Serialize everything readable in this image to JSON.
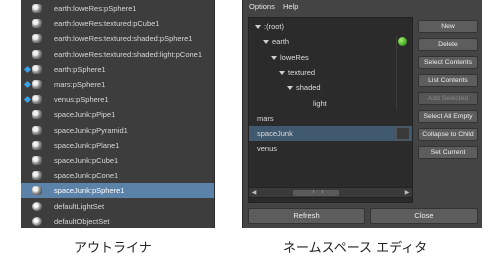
{
  "outliner": {
    "rows": [
      {
        "label": "earth:loweRes:pSphere1",
        "icon": "mesh-icon",
        "diamond": false,
        "selected": false
      },
      {
        "label": "earth:loweRes:textured:pCube1",
        "icon": "mesh-icon",
        "diamond": false,
        "selected": false
      },
      {
        "label": "earth:loweRes:textured:shaded:pSphere1",
        "icon": "mesh-icon",
        "diamond": false,
        "selected": false
      },
      {
        "label": "earth:loweRes:textured:shaded:light:pCone1",
        "icon": "mesh-icon",
        "diamond": false,
        "selected": false
      },
      {
        "label": "earth:pSphere1",
        "icon": "mesh-icon",
        "diamond": true,
        "selected": false
      },
      {
        "label": "mars:pSphere1",
        "icon": "mesh-icon",
        "diamond": true,
        "selected": false
      },
      {
        "label": "venus:pSphere1",
        "icon": "mesh-icon",
        "diamond": true,
        "selected": false
      },
      {
        "label": "spaceJunk:pPipe1",
        "icon": "mesh-icon",
        "diamond": false,
        "selected": false
      },
      {
        "label": "spaceJunk:pPyramid1",
        "icon": "mesh-icon",
        "diamond": false,
        "selected": false
      },
      {
        "label": "spaceJunk:pPlane1",
        "icon": "mesh-icon",
        "diamond": false,
        "selected": false
      },
      {
        "label": "spaceJunk:pCube1",
        "icon": "mesh-icon",
        "diamond": false,
        "selected": false
      },
      {
        "label": "spaceJunk:pCone1",
        "icon": "mesh-icon",
        "diamond": false,
        "selected": false
      },
      {
        "label": "spaceJunk:pSphere1",
        "icon": "mesh-icon",
        "diamond": false,
        "selected": true
      },
      {
        "label": "defaultLightSet",
        "icon": "set-icon",
        "diamond": false,
        "selected": false
      },
      {
        "label": "defaultObjectSet",
        "icon": "set-icon",
        "diamond": false,
        "selected": false
      }
    ]
  },
  "namespace_editor": {
    "menu": [
      "Options",
      "Help"
    ],
    "tree": [
      {
        "label": ":(root)",
        "expanded": true,
        "green_dot": false,
        "selected": false
      },
      {
        "label": "earth",
        "expanded": true,
        "green_dot": true,
        "selected": false
      },
      {
        "label": "loweRes",
        "expanded": true,
        "green_dot": false,
        "selected": false
      },
      {
        "label": "textured",
        "expanded": true,
        "green_dot": false,
        "selected": false
      },
      {
        "label": "shaded",
        "expanded": true,
        "green_dot": false,
        "selected": false
      },
      {
        "label": "light",
        "expanded": false,
        "green_dot": false,
        "selected": false
      },
      {
        "label": "mars",
        "expanded": false,
        "green_dot": false,
        "selected": false
      },
      {
        "label": "spaceJunk",
        "expanded": false,
        "green_dot": false,
        "selected": true
      },
      {
        "label": "venus",
        "expanded": false,
        "green_dot": false,
        "selected": false
      }
    ],
    "buttons": [
      {
        "label": "New",
        "enabled": true
      },
      {
        "label": "Delete",
        "enabled": true
      },
      {
        "label": "Select Contents",
        "enabled": true
      },
      {
        "label": "List Contents",
        "enabled": true
      },
      {
        "label": "Add Selected",
        "enabled": false
      },
      {
        "label": "Select All Empty",
        "enabled": true
      },
      {
        "label": "Collapse to Child",
        "enabled": true
      },
      {
        "label": "Set Current",
        "enabled": true
      }
    ],
    "refresh_label": "Refresh",
    "close_label": "Close"
  },
  "captions": {
    "outliner": "アウトライナ",
    "namespace_editor": "ネームスペース エディタ"
  },
  "colors": {
    "outliner_bg": "#3d3d3d",
    "selection": "#5b82a8",
    "panel_bg": "#444444",
    "accent_dot": "#3aa01e",
    "diamond": "#3aa0e8"
  }
}
